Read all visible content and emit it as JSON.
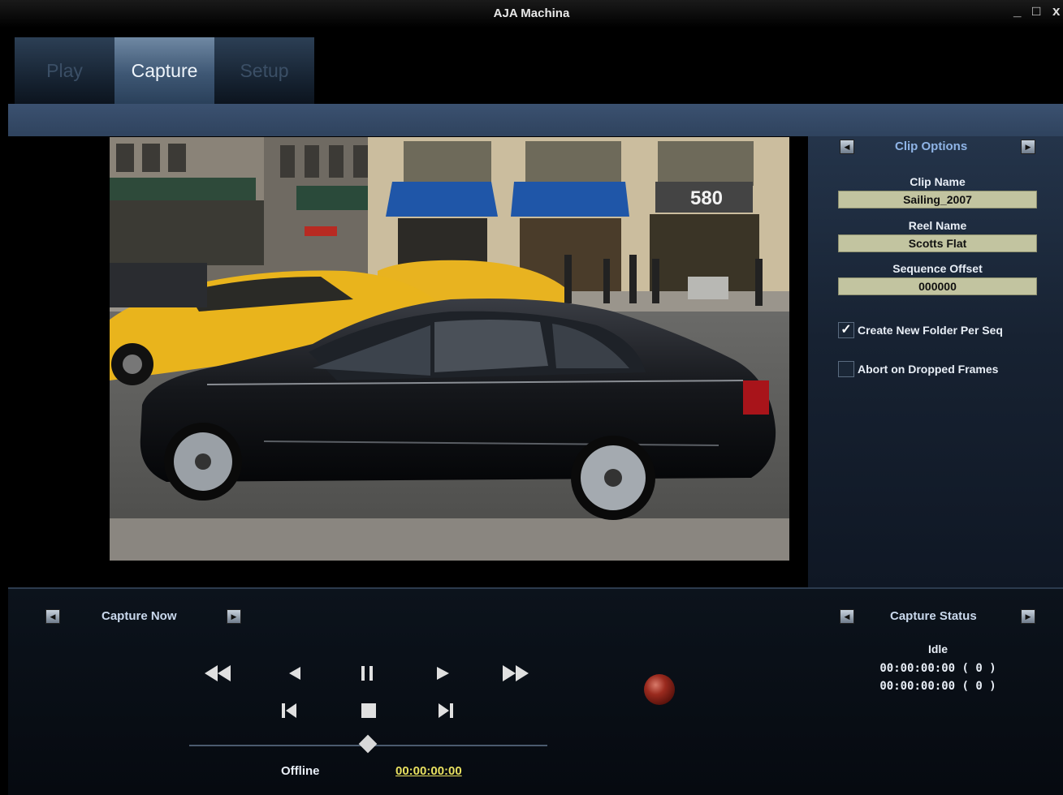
{
  "window": {
    "title": "AJA Machina",
    "controls": [
      "_",
      "□",
      "x"
    ]
  },
  "tabs": [
    {
      "label": "Play",
      "active": false
    },
    {
      "label": "Capture",
      "active": true
    },
    {
      "label": "Setup",
      "active": false
    }
  ],
  "clip_options": {
    "header": "Clip Options",
    "clip_name_label": "Clip Name",
    "clip_name_value": "Sailing_2007",
    "reel_name_label": "Reel Name",
    "reel_name_value": "Scotts Flat",
    "sequence_offset_label": "Sequence Offset",
    "sequence_offset_value": "000000",
    "create_folder_label": "Create New Folder Per Seq",
    "create_folder_checked": true,
    "abort_dropped_label": "Abort on Dropped Frames",
    "abort_dropped_checked": false
  },
  "video": {
    "store_number": "580"
  },
  "capture": {
    "mode_label": "Capture Now",
    "offline_label": "Offline",
    "timecode": "00:00:00:00",
    "scrub_position": 0.5
  },
  "capture_status": {
    "header": "Capture Status",
    "state": "Idle",
    "line1": "00:00:00:00  ( 0 )",
    "line2": "00:00:00:00  ( 0 )"
  },
  "colors": {
    "accent": "#8fb4e6",
    "field_bg": "#c2c4a0",
    "timecode": "#e8e060"
  }
}
